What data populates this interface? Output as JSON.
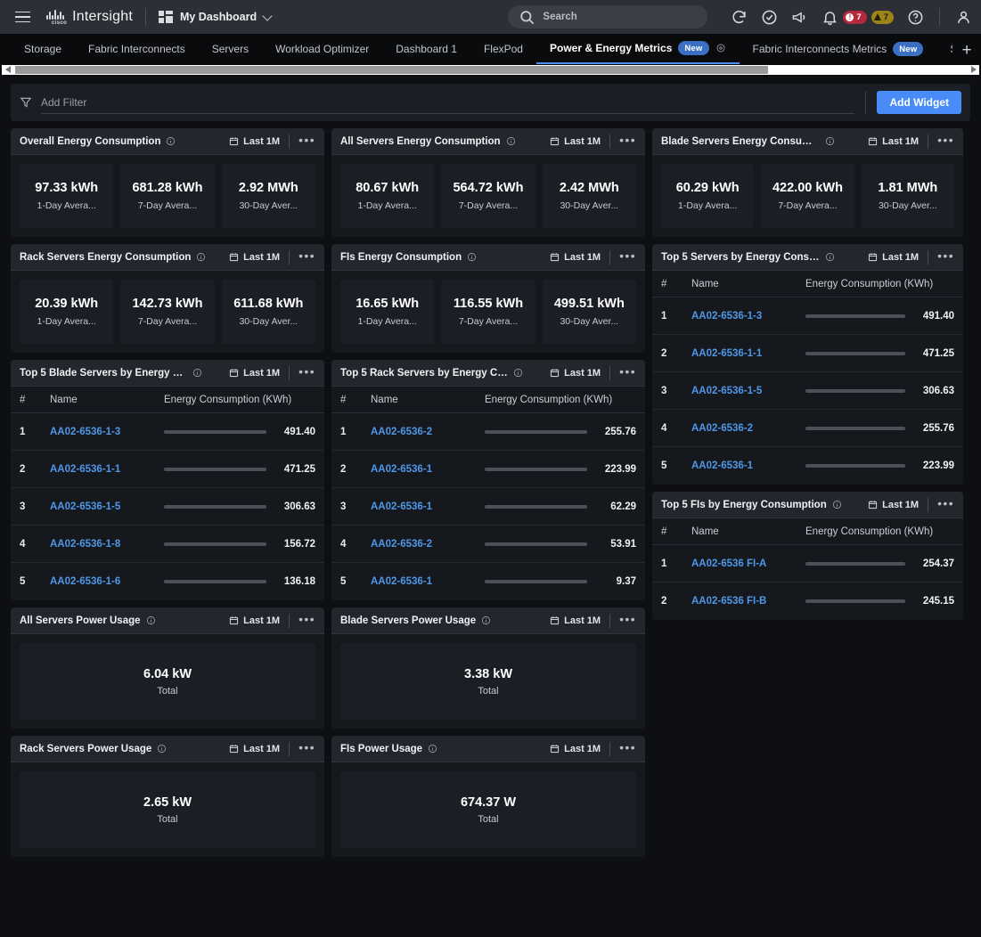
{
  "topbar": {
    "brand": "Intersight",
    "dashboard_name": "My Dashboard",
    "search_placeholder": "Search",
    "cisco_word": "cisco",
    "alerts": {
      "critical_count": "7",
      "warning_count": "7"
    }
  },
  "tabs": [
    {
      "label": "Storage",
      "active": false,
      "new": false
    },
    {
      "label": "Fabric Interconnects",
      "active": false,
      "new": false
    },
    {
      "label": "Servers",
      "active": false,
      "new": false
    },
    {
      "label": "Workload Optimizer",
      "active": false,
      "new": false
    },
    {
      "label": "Dashboard 1",
      "active": false,
      "new": false
    },
    {
      "label": "FlexPod",
      "active": false,
      "new": false
    },
    {
      "label": "Power & Energy Metrics",
      "active": true,
      "new": true,
      "new_label": "New"
    },
    {
      "label": "Fabric Interconnects Metrics",
      "active": false,
      "new": true,
      "new_label": "New"
    },
    {
      "label": "S",
      "active": false,
      "new": false
    }
  ],
  "add_tab_label": "+",
  "filterbar": {
    "placeholder": "Add Filter",
    "add_widget_label": "Add Widget"
  },
  "common": {
    "timerange": "Last 1M",
    "menu_dots": "•••",
    "col_rank": "#",
    "col_name": "Name",
    "col_energy": "Energy Consumption (KWh)",
    "total_label": "Total"
  },
  "chart_data": [
    {
      "type": "table",
      "title": "Overall Energy Consumption",
      "widget": "metric-tiles",
      "categories": [
        "1-Day Avera...",
        "7-Day Avera...",
        "30-Day Aver..."
      ],
      "values": [
        "97.33 kWh",
        "681.28 kWh",
        "2.92 MWh"
      ]
    },
    {
      "type": "table",
      "title": "All Servers Energy Consumption",
      "widget": "metric-tiles",
      "categories": [
        "1-Day Avera...",
        "7-Day Avera...",
        "30-Day Aver..."
      ],
      "values": [
        "80.67 kWh",
        "564.72 kWh",
        "2.42 MWh"
      ]
    },
    {
      "type": "table",
      "title": "Blade Servers Energy Consumpti...",
      "widget": "metric-tiles",
      "categories": [
        "1-Day Avera...",
        "7-Day Avera...",
        "30-Day Aver..."
      ],
      "values": [
        "60.29 kWh",
        "422.00 kWh",
        "1.81 MWh"
      ]
    },
    {
      "type": "table",
      "title": "Rack Servers Energy Consumption",
      "widget": "metric-tiles",
      "categories": [
        "1-Day Avera...",
        "7-Day Avera...",
        "30-Day Aver..."
      ],
      "values": [
        "20.39 kWh",
        "142.73 kWh",
        "611.68 kWh"
      ]
    },
    {
      "type": "table",
      "title": "FIs Energy Consumption",
      "widget": "metric-tiles",
      "categories": [
        "1-Day Avera...",
        "7-Day Avera...",
        "30-Day Aver..."
      ],
      "values": [
        "16.65 kWh",
        "116.55 kWh",
        "499.51 kWh"
      ]
    },
    {
      "type": "bar",
      "title": "Top 5 Servers by Energy Consum...",
      "xlabel": "Energy Consumption (KWh)",
      "ylabel": "Name",
      "categories": [
        "AA02-6536-1-3",
        "AA02-6536-1-1",
        "AA02-6536-1-5",
        "AA02-6536-2",
        "AA02-6536-1"
      ],
      "values": [
        491.4,
        471.25,
        306.63,
        255.76,
        223.99
      ],
      "xlim": [
        0,
        491.4
      ]
    },
    {
      "type": "bar",
      "title": "Top 5 Blade Servers by Energy C...",
      "xlabel": "Energy Consumption (KWh)",
      "ylabel": "Name",
      "categories": [
        "AA02-6536-1-3",
        "AA02-6536-1-1",
        "AA02-6536-1-5",
        "AA02-6536-1-8",
        "AA02-6536-1-6"
      ],
      "values": [
        491.4,
        471.25,
        306.63,
        156.72,
        136.18
      ],
      "xlim": [
        0,
        491.4
      ]
    },
    {
      "type": "bar",
      "title": "Top 5 Rack Servers by Energy Co...",
      "xlabel": "Energy Consumption (KWh)",
      "ylabel": "Name",
      "categories": [
        "AA02-6536-2",
        "AA02-6536-1",
        "AA02-6536-1",
        "AA02-6536-2",
        "AA02-6536-1"
      ],
      "values": [
        255.76,
        223.99,
        62.29,
        53.91,
        9.37
      ],
      "xlim": [
        0,
        255.76
      ]
    },
    {
      "type": "bar",
      "title": "Top 5 FIs by Energy Consumption",
      "xlabel": "Energy Consumption (KWh)",
      "ylabel": "Name",
      "categories": [
        "AA02-6536 FI-A",
        "AA02-6536 FI-B"
      ],
      "values": [
        254.37,
        245.15
      ],
      "xlim": [
        0,
        254.37
      ]
    },
    {
      "type": "table",
      "title": "All Servers Power Usage",
      "widget": "total",
      "categories": [
        "Total"
      ],
      "values": [
        "6.04 kW"
      ]
    },
    {
      "type": "table",
      "title": "Blade Servers Power Usage",
      "widget": "total",
      "categories": [
        "Total"
      ],
      "values": [
        "3.38 kW"
      ]
    },
    {
      "type": "table",
      "title": "Rack Servers Power Usage",
      "widget": "total",
      "categories": [
        "Total"
      ],
      "values": [
        "2.65 kW"
      ]
    },
    {
      "type": "table",
      "title": "FIs Power Usage",
      "widget": "total",
      "categories": [
        "Total"
      ],
      "values": [
        "674.37 W"
      ]
    }
  ],
  "colors": {
    "accent_blue": "#4a8cf7",
    "link_blue": "#4f97e8",
    "bar_fill": "#7cc6e8",
    "bar_track": "#4c5159",
    "critical_red": "#b5293c",
    "warning_yellow": "#9d8418"
  }
}
